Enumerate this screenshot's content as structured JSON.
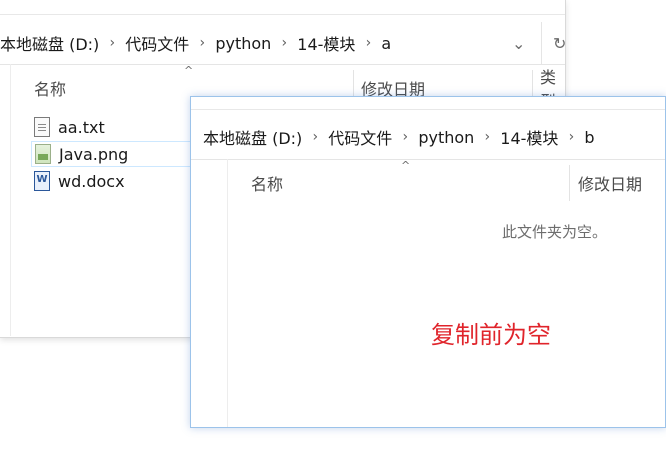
{
  "window_a": {
    "breadcrumb": [
      "本地磁盘 (D:)",
      "代码文件",
      "python",
      "14-模块",
      "a"
    ],
    "separator": "›",
    "dropdown_glyph": "⌄",
    "refresh_glyph": "↻",
    "columns": {
      "name": "名称",
      "date": "修改日期",
      "type": "类型"
    },
    "files": [
      {
        "name": "aa.txt",
        "icon": "text-file-icon"
      },
      {
        "name": "Java.png",
        "icon": "image-file-icon"
      },
      {
        "name": "wd.docx",
        "icon": "word-file-icon"
      }
    ]
  },
  "window_b": {
    "breadcrumb": [
      "本地磁盘 (D:)",
      "代码文件",
      "python",
      "14-模块",
      "b"
    ],
    "separator": "›",
    "columns": {
      "name": "名称",
      "date": "修改日期"
    },
    "empty_message": "此文件夹为空。"
  },
  "annotation": {
    "text": "复制前为空",
    "color": "#e0242b"
  },
  "sort_glyph": "^"
}
